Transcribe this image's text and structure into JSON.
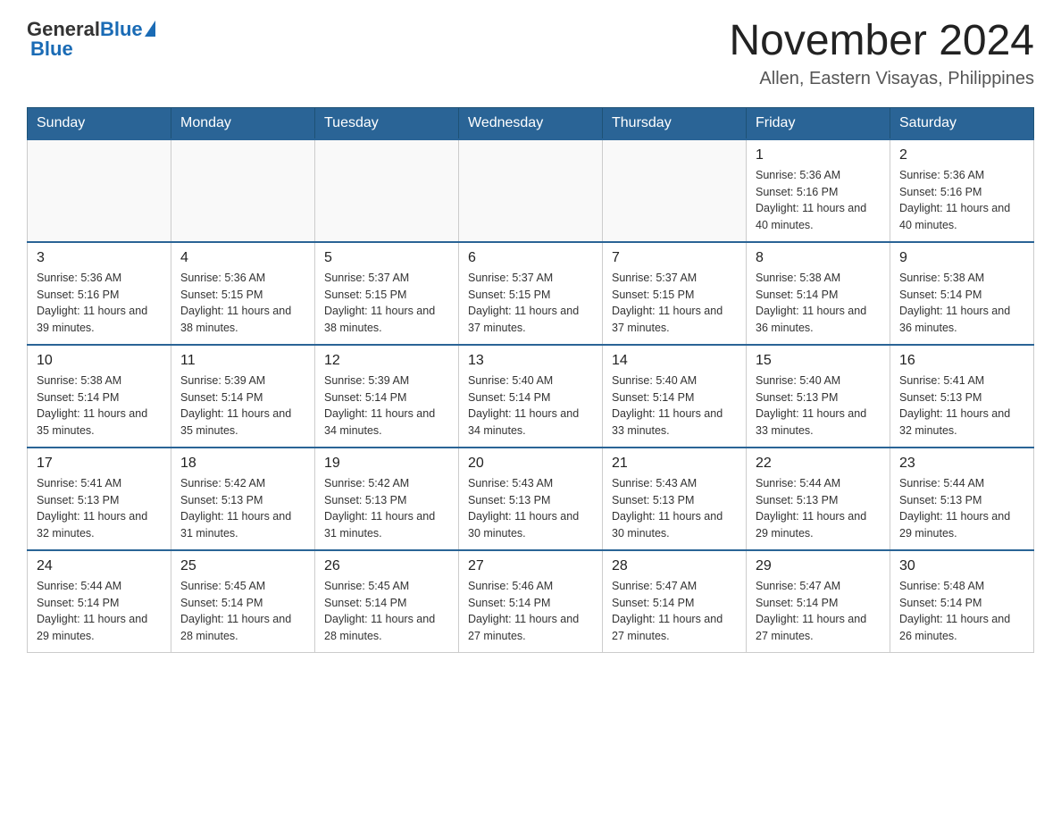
{
  "header": {
    "logo": {
      "general": "General",
      "blue": "Blue"
    },
    "title": "November 2024",
    "location": "Allen, Eastern Visayas, Philippines"
  },
  "days_of_week": [
    "Sunday",
    "Monday",
    "Tuesday",
    "Wednesday",
    "Thursday",
    "Friday",
    "Saturday"
  ],
  "weeks": [
    [
      {
        "day": "",
        "info": ""
      },
      {
        "day": "",
        "info": ""
      },
      {
        "day": "",
        "info": ""
      },
      {
        "day": "",
        "info": ""
      },
      {
        "day": "",
        "info": ""
      },
      {
        "day": "1",
        "info": "Sunrise: 5:36 AM\nSunset: 5:16 PM\nDaylight: 11 hours and 40 minutes."
      },
      {
        "day": "2",
        "info": "Sunrise: 5:36 AM\nSunset: 5:16 PM\nDaylight: 11 hours and 40 minutes."
      }
    ],
    [
      {
        "day": "3",
        "info": "Sunrise: 5:36 AM\nSunset: 5:16 PM\nDaylight: 11 hours and 39 minutes."
      },
      {
        "day": "4",
        "info": "Sunrise: 5:36 AM\nSunset: 5:15 PM\nDaylight: 11 hours and 38 minutes."
      },
      {
        "day": "5",
        "info": "Sunrise: 5:37 AM\nSunset: 5:15 PM\nDaylight: 11 hours and 38 minutes."
      },
      {
        "day": "6",
        "info": "Sunrise: 5:37 AM\nSunset: 5:15 PM\nDaylight: 11 hours and 37 minutes."
      },
      {
        "day": "7",
        "info": "Sunrise: 5:37 AM\nSunset: 5:15 PM\nDaylight: 11 hours and 37 minutes."
      },
      {
        "day": "8",
        "info": "Sunrise: 5:38 AM\nSunset: 5:14 PM\nDaylight: 11 hours and 36 minutes."
      },
      {
        "day": "9",
        "info": "Sunrise: 5:38 AM\nSunset: 5:14 PM\nDaylight: 11 hours and 36 minutes."
      }
    ],
    [
      {
        "day": "10",
        "info": "Sunrise: 5:38 AM\nSunset: 5:14 PM\nDaylight: 11 hours and 35 minutes."
      },
      {
        "day": "11",
        "info": "Sunrise: 5:39 AM\nSunset: 5:14 PM\nDaylight: 11 hours and 35 minutes."
      },
      {
        "day": "12",
        "info": "Sunrise: 5:39 AM\nSunset: 5:14 PM\nDaylight: 11 hours and 34 minutes."
      },
      {
        "day": "13",
        "info": "Sunrise: 5:40 AM\nSunset: 5:14 PM\nDaylight: 11 hours and 34 minutes."
      },
      {
        "day": "14",
        "info": "Sunrise: 5:40 AM\nSunset: 5:14 PM\nDaylight: 11 hours and 33 minutes."
      },
      {
        "day": "15",
        "info": "Sunrise: 5:40 AM\nSunset: 5:13 PM\nDaylight: 11 hours and 33 minutes."
      },
      {
        "day": "16",
        "info": "Sunrise: 5:41 AM\nSunset: 5:13 PM\nDaylight: 11 hours and 32 minutes."
      }
    ],
    [
      {
        "day": "17",
        "info": "Sunrise: 5:41 AM\nSunset: 5:13 PM\nDaylight: 11 hours and 32 minutes."
      },
      {
        "day": "18",
        "info": "Sunrise: 5:42 AM\nSunset: 5:13 PM\nDaylight: 11 hours and 31 minutes."
      },
      {
        "day": "19",
        "info": "Sunrise: 5:42 AM\nSunset: 5:13 PM\nDaylight: 11 hours and 31 minutes."
      },
      {
        "day": "20",
        "info": "Sunrise: 5:43 AM\nSunset: 5:13 PM\nDaylight: 11 hours and 30 minutes."
      },
      {
        "day": "21",
        "info": "Sunrise: 5:43 AM\nSunset: 5:13 PM\nDaylight: 11 hours and 30 minutes."
      },
      {
        "day": "22",
        "info": "Sunrise: 5:44 AM\nSunset: 5:13 PM\nDaylight: 11 hours and 29 minutes."
      },
      {
        "day": "23",
        "info": "Sunrise: 5:44 AM\nSunset: 5:13 PM\nDaylight: 11 hours and 29 minutes."
      }
    ],
    [
      {
        "day": "24",
        "info": "Sunrise: 5:44 AM\nSunset: 5:14 PM\nDaylight: 11 hours and 29 minutes."
      },
      {
        "day": "25",
        "info": "Sunrise: 5:45 AM\nSunset: 5:14 PM\nDaylight: 11 hours and 28 minutes."
      },
      {
        "day": "26",
        "info": "Sunrise: 5:45 AM\nSunset: 5:14 PM\nDaylight: 11 hours and 28 minutes."
      },
      {
        "day": "27",
        "info": "Sunrise: 5:46 AM\nSunset: 5:14 PM\nDaylight: 11 hours and 27 minutes."
      },
      {
        "day": "28",
        "info": "Sunrise: 5:47 AM\nSunset: 5:14 PM\nDaylight: 11 hours and 27 minutes."
      },
      {
        "day": "29",
        "info": "Sunrise: 5:47 AM\nSunset: 5:14 PM\nDaylight: 11 hours and 27 minutes."
      },
      {
        "day": "30",
        "info": "Sunrise: 5:48 AM\nSunset: 5:14 PM\nDaylight: 11 hours and 26 minutes."
      }
    ]
  ]
}
